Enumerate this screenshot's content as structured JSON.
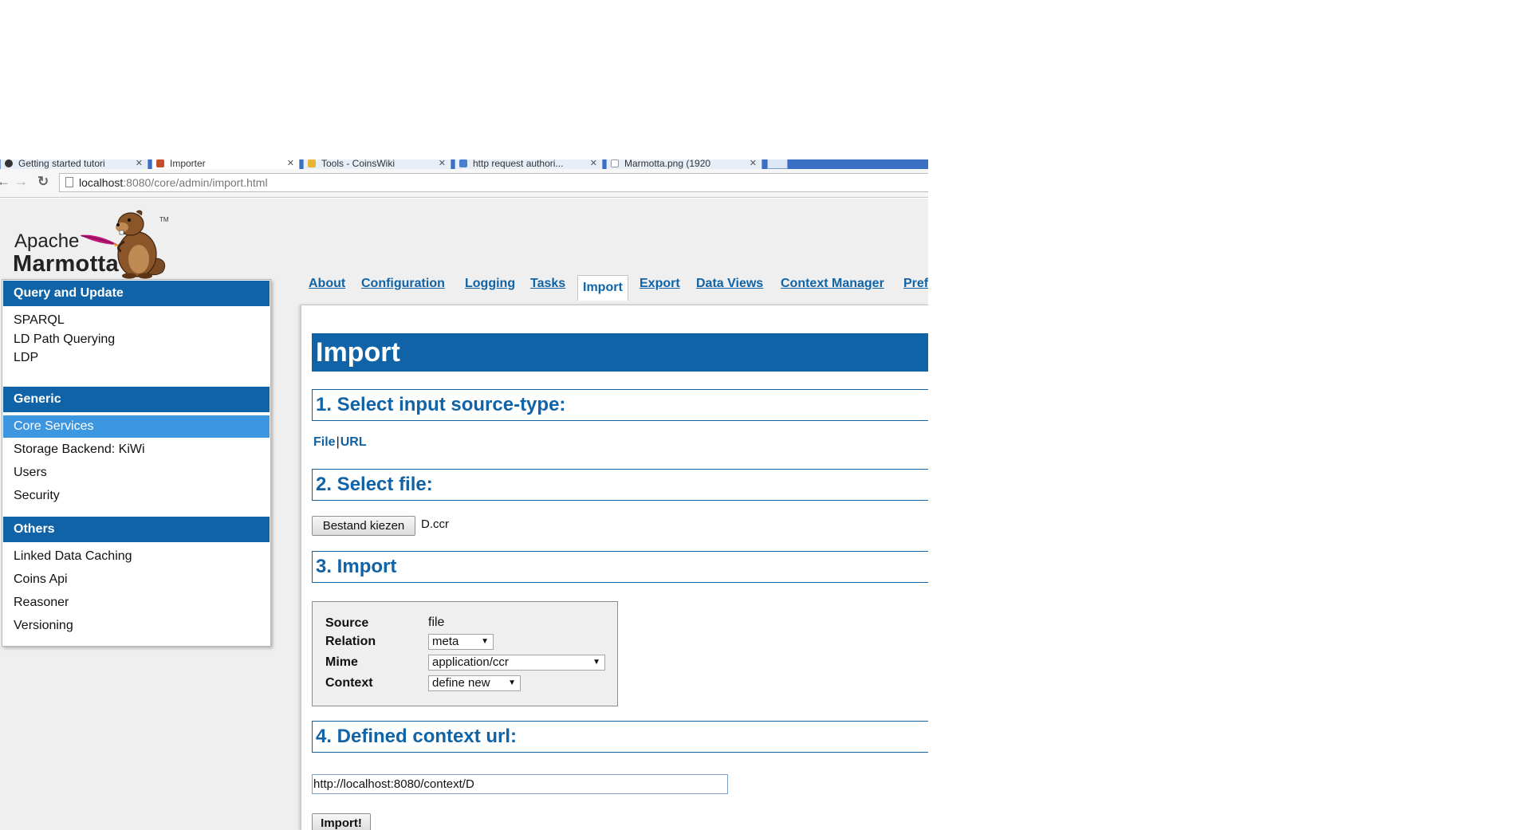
{
  "browser": {
    "tabs": [
      {
        "title": "Getting started tutori"
      },
      {
        "title": "Importer"
      },
      {
        "title": "Tools - CoinsWiki"
      },
      {
        "title": "http request authori..."
      },
      {
        "title": "Marmotta.png (1920"
      }
    ],
    "url_host": "localhost",
    "url_path": ":8080/core/admin/import.html"
  },
  "logo": {
    "line1": "Apache",
    "line2": "Marmotta",
    "tm": "TM"
  },
  "sidebar": {
    "sections": [
      {
        "title": "Query and Update",
        "items": [
          "SPARQL",
          "LD Path Querying",
          "LDP"
        ]
      },
      {
        "title": "Generic",
        "items": [
          "Core Services",
          "Storage Backend: KiWi",
          "Users",
          "Security"
        ],
        "active": "Core Services"
      },
      {
        "title": "Others",
        "items": [
          "Linked Data Caching",
          "Coins Api",
          "Reasoner",
          "Versioning"
        ]
      }
    ]
  },
  "nav": {
    "tabs": [
      "About",
      "Configuration",
      "Logging",
      "Tasks",
      "Import",
      "Export",
      "Data Views",
      "Context Manager",
      "Prefix"
    ],
    "active": "Import"
  },
  "main": {
    "title": "Import",
    "step1": "1. Select input source-type:",
    "source_file": "File",
    "source_sep": "|",
    "source_url": "URL",
    "step2": "2. Select file:",
    "file_button": "Bestand kiezen",
    "file_name": "D.ccr",
    "step3": "3. Import",
    "form": {
      "source_label": "Source",
      "source_value": "file",
      "relation_label": "Relation",
      "relation_value": "meta",
      "mime_label": "Mime",
      "mime_value": "application/ccr",
      "context_label": "Context",
      "context_value": "define new"
    },
    "step4": "4. Defined context url:",
    "context_url": "http://localhost:8080/context/D",
    "import_button": "Import!"
  },
  "colors": {
    "brand": "#0f63a6",
    "active_item": "#3d97e0",
    "tabbar": "#3b6fc4"
  }
}
